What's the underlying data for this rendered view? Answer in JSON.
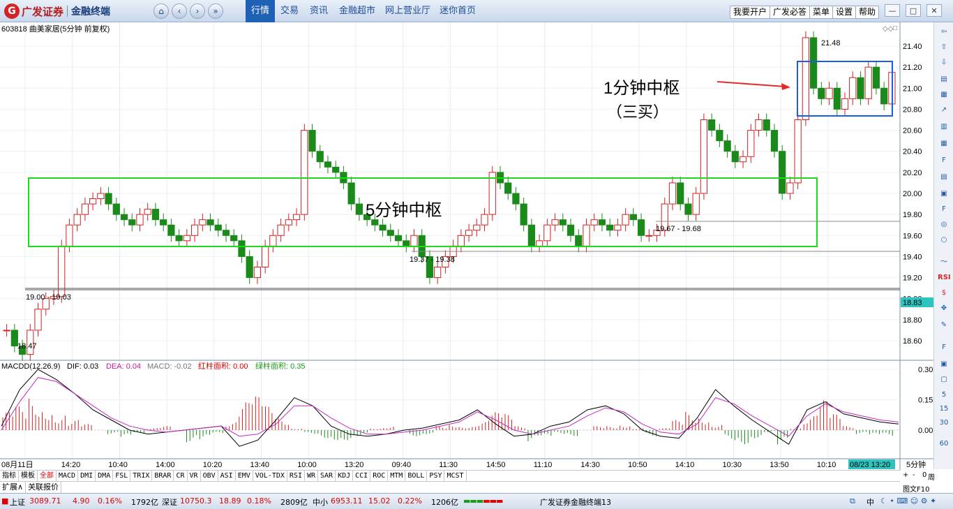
{
  "app": {
    "brand": "广发证券",
    "product": "金融终端",
    "menu": [
      "行情",
      "交易",
      "资讯",
      "金融超市",
      "网上营业厅",
      "迷你首页"
    ],
    "active_menu": "行情",
    "right_buttons": [
      "我要开户",
      "广发必答",
      "菜单",
      "设置",
      "帮助"
    ]
  },
  "stock": {
    "header": "603818 曲美家居(5分钟 前复权)"
  },
  "annotations": {
    "box_1min_label": "1分钟中枢",
    "box_1min_sub": "（三买）",
    "box_5min_label": "5分钟中枢",
    "high_label": "21.48",
    "low_label": "18.47",
    "level_a": "19.00 - 19.03",
    "level_b": "19.37 - 19.38",
    "level_c": "19.67 - 19.68",
    "current_price": "18.83"
  },
  "macd": {
    "header_name": "MACDD(12,26,9)",
    "dif": "DIF: 0.03",
    "dea": "DEA: 0.04",
    "macd": "MACD: -0.02",
    "red_area": "红柱面积: 0.00",
    "green_area": "绿柱面积: 0.35"
  },
  "chart_data": {
    "type": "candlestick",
    "price_axis": [
      "21.40",
      "21.20",
      "21.00",
      "20.80",
      "20.60",
      "20.40",
      "20.20",
      "20.00",
      "19.80",
      "19.60",
      "19.40",
      "19.20",
      "19.00",
      "18.80",
      "18.60"
    ],
    "ylim": [
      18.4,
      21.6
    ],
    "macd_axis": [
      "0.30",
      "0.15",
      "0.00"
    ],
    "time_labels": [
      "08月11日",
      "14:20",
      "10:40",
      "14:00",
      "10:20",
      "13:40",
      "10:00",
      "13:20",
      "09:40",
      "11:30",
      "14:50",
      "11:10",
      "14:30",
      "10:50",
      "14:10",
      "10:30",
      "13:50",
      "10:10"
    ],
    "time_badge": "08/23 13:20",
    "period": "5分钟",
    "price_path": [
      18.7,
      18.55,
      18.47,
      18.7,
      18.9,
      19.0,
      19.02,
      19.5,
      19.7,
      19.8,
      19.9,
      19.95,
      20.0,
      19.9,
      19.8,
      19.75,
      19.7,
      19.8,
      19.85,
      19.75,
      19.7,
      19.6,
      19.55,
      19.6,
      19.7,
      19.75,
      19.7,
      19.65,
      19.6,
      19.55,
      19.4,
      19.2,
      19.3,
      19.5,
      19.6,
      19.7,
      19.75,
      19.8,
      20.6,
      20.4,
      20.3,
      20.25,
      20.2,
      20.1,
      19.9,
      19.8,
      19.75,
      19.7,
      19.65,
      19.6,
      19.55,
      19.5,
      19.6,
      19.4,
      19.2,
      19.3,
      19.4,
      19.5,
      19.6,
      19.65,
      19.7,
      19.8,
      20.2,
      20.1,
      20.0,
      19.9,
      19.7,
      19.5,
      19.55,
      19.7,
      19.75,
      19.7,
      19.6,
      19.5,
      19.7,
      19.75,
      19.7,
      19.65,
      19.7,
      19.8,
      19.75,
      19.6,
      19.6,
      19.65,
      19.9,
      20.1,
      19.9,
      19.8,
      20.0,
      20.7,
      20.6,
      20.5,
      20.4,
      20.3,
      20.35,
      20.6,
      20.7,
      20.6,
      20.4,
      20.0,
      20.1,
      20.7,
      21.48,
      21.0,
      20.9,
      21.0,
      20.8,
      20.9,
      21.1,
      20.9,
      21.2,
      21.0,
      20.85,
      21.15
    ],
    "macd_hist": [
      0.09,
      0.12,
      0.16,
      0.12,
      0.08,
      0.05,
      0.03,
      0.0,
      -0.02,
      -0.04,
      -0.02,
      0.01,
      0.02,
      0.0,
      -0.06,
      -0.05,
      -0.02,
      0.04,
      0.14,
      0.17,
      0.12,
      0.06,
      0.01,
      -0.02,
      -0.04,
      -0.05,
      -0.05,
      -0.03,
      0.01,
      0.02,
      0.0,
      -0.03,
      -0.02,
      0.02,
      0.03,
      0.02,
      0.04,
      0.09,
      0.08,
      0.02,
      -0.06,
      -0.04,
      -0.02,
      -0.03,
      0.0,
      0.02,
      0.02,
      0.03,
      0.01,
      -0.03,
      0.01,
      0.05,
      0.09,
      0.07,
      0.03,
      -0.05,
      -0.07,
      -0.04,
      -0.01,
      -0.08,
      0.01,
      0.07,
      0.15,
      0.08,
      0.02,
      -0.02,
      -0.03,
      -0.03
    ],
    "dif_line": [
      0.02,
      0.2,
      0.3,
      0.25,
      0.18,
      0.1,
      0.05,
      0.0,
      -0.02,
      -0.01,
      0.0,
      0.01,
      0.02,
      -0.08,
      -0.05,
      0.05,
      0.16,
      0.12,
      0.02,
      -0.02,
      -0.03,
      -0.02,
      0.0,
      0.01,
      0.03,
      0.05,
      0.1,
      0.03,
      -0.03,
      -0.02,
      0.02,
      0.04,
      0.1,
      0.12,
      0.08,
      0.0,
      -0.03,
      -0.04,
      0.06,
      0.2,
      0.12,
      0.05,
      -0.01,
      -0.07,
      0.1,
      0.14,
      0.08,
      0.06,
      0.04,
      0.03
    ],
    "dea_line": [
      0.0,
      0.14,
      0.26,
      0.24,
      0.18,
      0.12,
      0.06,
      0.02,
      0.0,
      -0.01,
      0.0,
      0.01,
      0.02,
      -0.03,
      -0.02,
      0.03,
      0.12,
      0.12,
      0.06,
      0.01,
      -0.02,
      -0.02,
      -0.01,
      0.0,
      0.02,
      0.04,
      0.09,
      0.05,
      0.0,
      -0.02,
      0.0,
      0.02,
      0.07,
      0.11,
      0.09,
      0.03,
      -0.01,
      -0.02,
      0.03,
      0.16,
      0.13,
      0.07,
      0.02,
      -0.03,
      0.07,
      0.13,
      0.09,
      0.07,
      0.05,
      0.04
    ]
  },
  "indicators": [
    "指标",
    "模板",
    "全部",
    "MACD",
    "DMI",
    "DMA",
    "FSL",
    "TRIX",
    "BRAR",
    "CR",
    "VR",
    "OBV",
    "ASI",
    "EMV",
    "VOL-TDX",
    "RSI",
    "WR",
    "SAR",
    "KDJ",
    "CCI",
    "ROC",
    "MTM",
    "BOLL",
    "PSY",
    "MCST"
  ],
  "active_indicator": "全部",
  "ext_tabs": [
    "扩展∧",
    "关联报价"
  ],
  "right_ctrl": [
    "+",
    "-",
    "0",
    "周",
    "图文F10"
  ],
  "status": {
    "sh_name": "上证",
    "sh_val": "3089.71",
    "sh_chg": "4.90",
    "sh_pct": "0.16%",
    "sh_vol": "1792亿",
    "sz_name": "深证",
    "sz_val": "10750.3",
    "sz_chg": "18.89",
    "sz_pct": "0.18%",
    "sz_vol": "2809亿",
    "zx_name": "中小",
    "zx_val": "6953.11",
    "zx_chg": "15.02",
    "zx_pct": "0.22%",
    "zx_vol": "1206亿",
    "terminal": "广发证券金融终端13",
    "ime": "中"
  }
}
